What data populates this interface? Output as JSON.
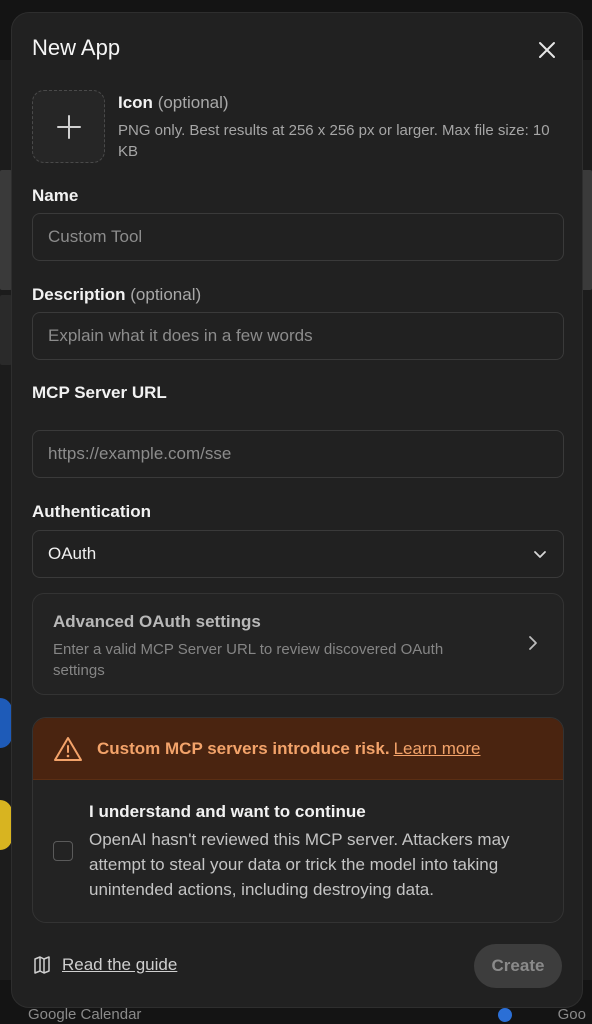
{
  "background": {
    "footer_left": "Google Calendar",
    "footer_right": "Goo"
  },
  "modal": {
    "title": "New App",
    "close_icon": "close-icon"
  },
  "icon_field": {
    "label": "Icon",
    "optional": "(optional)",
    "help": "PNG only. Best results at 256 x 256 px or larger. Max file size: 10 KB",
    "icon": "plus-icon"
  },
  "name_field": {
    "label": "Name",
    "placeholder": "Custom Tool",
    "value": ""
  },
  "description_field": {
    "label": "Description",
    "optional": "(optional)",
    "placeholder": "Explain what it does in a few words",
    "value": ""
  },
  "url_field": {
    "label": "MCP Server URL",
    "placeholder": "https://example.com/sse",
    "value": ""
  },
  "auth_field": {
    "label": "Authentication",
    "selected": "OAuth",
    "icon": "chevron-down-icon"
  },
  "advanced": {
    "title": "Advanced OAuth settings",
    "description": "Enter a valid MCP Server URL to review discovered OAuth settings",
    "icon": "chevron-right-icon"
  },
  "risk": {
    "warning": "Custom MCP servers introduce risk.",
    "link": "Learn more",
    "ack_title": "I understand and want to continue",
    "ack_description": "OpenAI hasn't reviewed this MCP server. Attackers may attempt to steal your data or trick the model into taking unintended actions, including destroying data.",
    "checked": false,
    "icon": "warning-icon",
    "color": "#f3a36a"
  },
  "footer": {
    "guide_label": "Read the guide",
    "guide_icon": "book-icon",
    "create_label": "Create"
  }
}
